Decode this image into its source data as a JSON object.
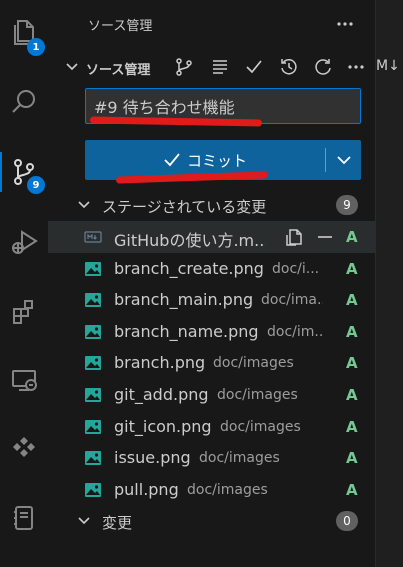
{
  "activity_bar": {
    "items": [
      {
        "name": "explorer",
        "badge": "1"
      },
      {
        "name": "search",
        "badge": ""
      },
      {
        "name": "source-control",
        "badge": "9"
      },
      {
        "name": "run-debug",
        "badge": ""
      },
      {
        "name": "extensions",
        "badge": ""
      },
      {
        "name": "remote-explorer",
        "badge": ""
      },
      {
        "name": "extension-pack",
        "badge": ""
      },
      {
        "name": "notebook",
        "badge": ""
      }
    ]
  },
  "sidebar": {
    "title": "ソース管理",
    "section_title": "ソース管理",
    "commit_message": "#9 待ち合わせ機能",
    "commit_button_label": "コミット",
    "staged": {
      "title": "ステージされている変更",
      "count": "9",
      "files": [
        {
          "name": "GitHubの使い方.m...",
          "path": "",
          "status": "A",
          "icon": "markdown-icon"
        },
        {
          "name": "branch_create.png",
          "path": "doc/i...",
          "status": "A",
          "icon": "image-icon"
        },
        {
          "name": "branch_main.png",
          "path": "doc/ima...",
          "status": "A",
          "icon": "image-icon"
        },
        {
          "name": "branch_name.png",
          "path": "doc/im...",
          "status": "A",
          "icon": "image-icon"
        },
        {
          "name": "branch.png",
          "path": "doc/images",
          "status": "A",
          "icon": "image-icon"
        },
        {
          "name": "git_add.png",
          "path": "doc/images",
          "status": "A",
          "icon": "image-icon"
        },
        {
          "name": "git_icon.png",
          "path": "doc/images",
          "status": "A",
          "icon": "image-icon"
        },
        {
          "name": "issue.png",
          "path": "doc/images",
          "status": "A",
          "icon": "image-icon"
        },
        {
          "name": "pull.png",
          "path": "doc/images",
          "status": "A",
          "icon": "image-icon"
        }
      ]
    },
    "changes": {
      "title": "変更",
      "count": "0"
    }
  },
  "editor": {
    "tab_label": "M↓ の使"
  },
  "colors": {
    "accent": "#0078d4",
    "button": "#0e639c",
    "added": "#73c991",
    "annotation": "#e01b1b"
  }
}
